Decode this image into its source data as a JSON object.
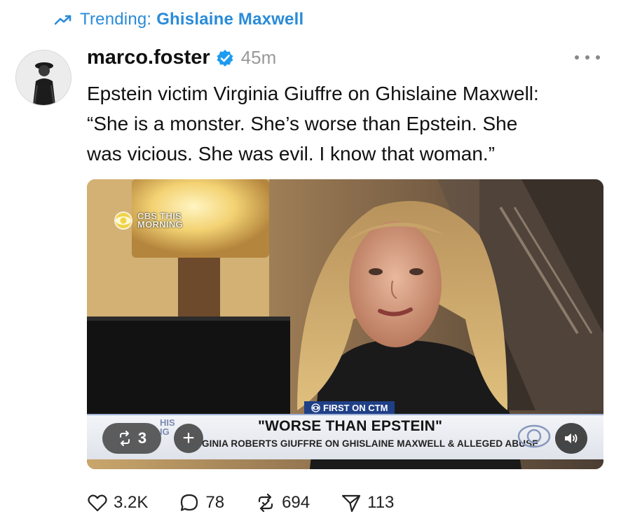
{
  "trending": {
    "prefix": "Trending:",
    "topic": "Ghislaine Maxwell",
    "icon": "trending-up-icon"
  },
  "colors": {
    "accent": "#2a8bd8",
    "verified": "#1d9bf0",
    "text": "#111111",
    "muted": "#999999"
  },
  "post": {
    "author": "marco.foster",
    "verified": true,
    "time": "45m",
    "text_lines": [
      "Epstein victim Virginia Giuffre on Ghislaine Maxwell:",
      "“She is a monster. She’s worse than Epstein. She",
      "was vicious. She was evil. I know that woman.”"
    ]
  },
  "video": {
    "network_bug": [
      "CBS THIS",
      "MORNING"
    ],
    "flag": "FIRST ON CTM",
    "headline": "\"WORSE THAN EPSTEIN\"",
    "subline": "GINIA ROBERTS GIUFFRE ON GHISLAINE MAXWELL & ALLEGED ABUSE",
    "network_fragment": [
      "HIS",
      "IG"
    ],
    "repost_count": "3",
    "add_label": "+",
    "sound_icon": "speaker-icon"
  },
  "actions": {
    "likes": "3.2K",
    "replies": "78",
    "reposts": "694",
    "shares": "113"
  }
}
